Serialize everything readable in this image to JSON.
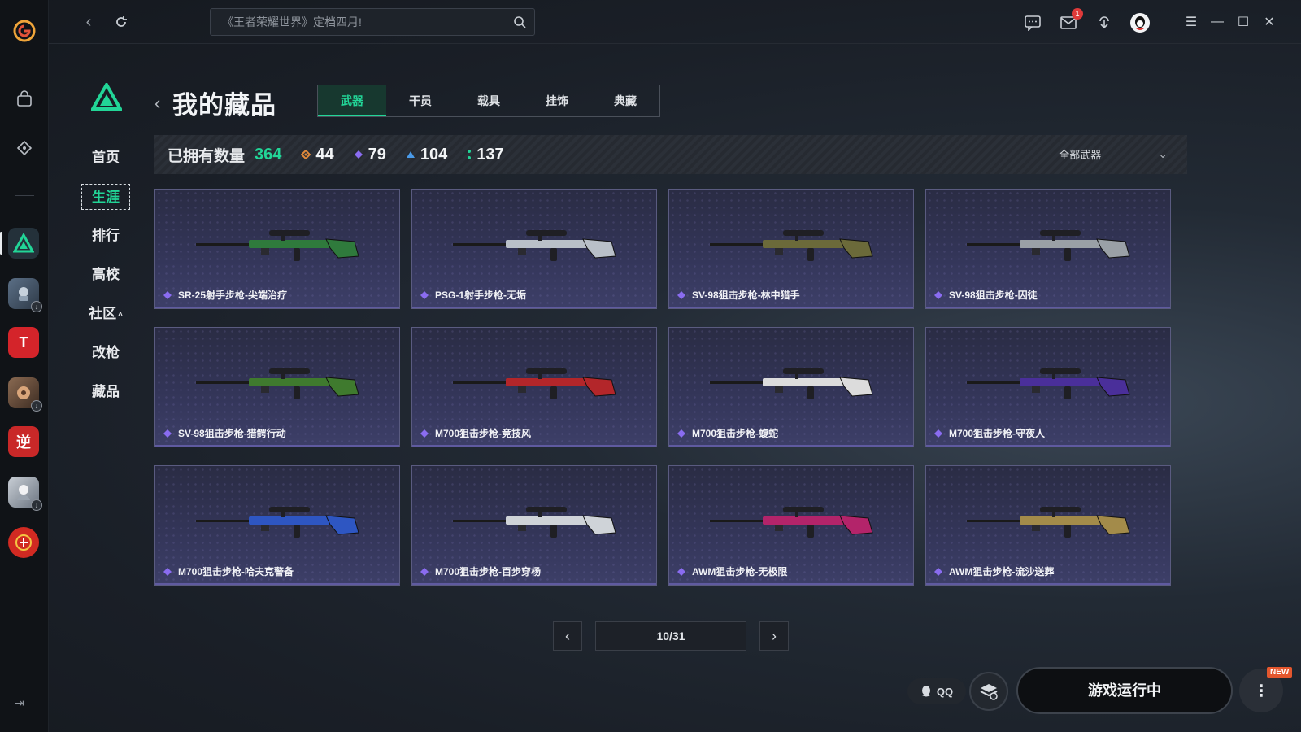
{
  "topbar": {
    "search_placeholder": "《王者荣耀世界》定档四月!",
    "mail_badge": "1",
    "icons": [
      "back-icon",
      "refresh-icon",
      "search-icon",
      "chat-icon",
      "mail-icon",
      "download-icon",
      "avatar-icon",
      "menu-icon",
      "minimize-icon",
      "maximize-icon",
      "close-icon"
    ]
  },
  "rail": {
    "apps": [
      {
        "name": "delta-force",
        "active": true
      },
      {
        "name": "game-2"
      },
      {
        "name": "game-3",
        "label": "T"
      },
      {
        "name": "game-4"
      },
      {
        "name": "game-5",
        "label": "逆"
      },
      {
        "name": "game-6"
      },
      {
        "name": "crossfire"
      }
    ]
  },
  "side_nav": [
    "首页",
    "生涯",
    "排行",
    "高校",
    "社区",
    "改枪",
    "藏品"
  ],
  "page": {
    "title": "我的藏品",
    "tabs": [
      "武器",
      "干员",
      "载具",
      "挂饰",
      "典藏"
    ],
    "active_tab": 0
  },
  "stats": {
    "owned_label": "已拥有数量",
    "owned_count": "364",
    "gold": "44",
    "purple": "79",
    "blue": "104",
    "green": "137",
    "filter": "全部武器"
  },
  "items": [
    {
      "name": "SR-25射手步枪-尖端治疗",
      "color": "#2f7a3c"
    },
    {
      "name": "PSG-1射手步枪-无垢",
      "color": "#b9c0c8"
    },
    {
      "name": "SV-98狙击步枪-林中猎手",
      "color": "#6b6a3a"
    },
    {
      "name": "SV-98狙击步枪-囚徒",
      "color": "#9aa0a6"
    },
    {
      "name": "SV-98狙击步枪-猎鳄行动",
      "color": "#3f7a2e"
    },
    {
      "name": "M700狙击步枪-竞技风",
      "color": "#b3262a"
    },
    {
      "name": "M700狙击步枪-蝮蛇",
      "color": "#dcdcdc"
    },
    {
      "name": "M700狙击步枪-守夜人",
      "color": "#4a2f9a"
    },
    {
      "name": "M700狙击步枪-哈夫克警备",
      "color": "#2e56c2"
    },
    {
      "name": "M700狙击步枪-百步穿杨",
      "color": "#cfd3d8"
    },
    {
      "name": "AWM狙击步枪-无极限",
      "color": "#b3246a"
    },
    {
      "name": "AWM狙击步枪-流沙送葬",
      "color": "#a38b4a"
    }
  ],
  "pager": {
    "text": "10/31"
  },
  "bottom": {
    "qq_label": "QQ",
    "launch_label": "游戏运行中",
    "new_tag": "NEW"
  }
}
